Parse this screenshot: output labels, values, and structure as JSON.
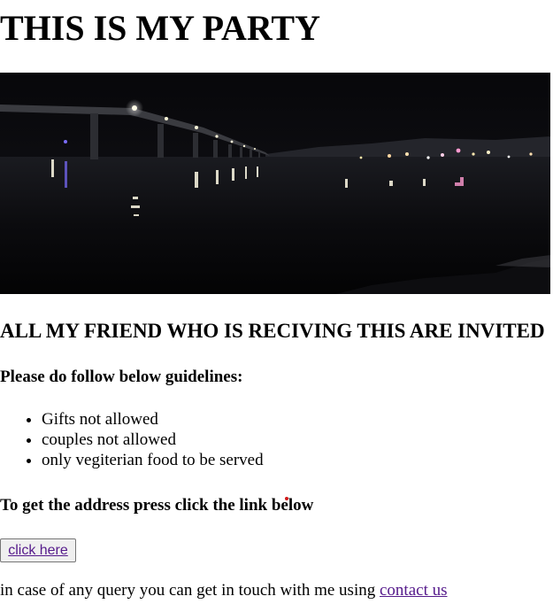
{
  "header": {
    "title": "THIS IS MY PARTY"
  },
  "hero": {
    "alt": "Night view of a long bridge over water with city lights reflecting"
  },
  "content": {
    "invite_heading": "ALL MY FRIEND WHO IS RECIVING THIS ARE INVITED",
    "guidelines_heading": "Please do follow below guidelines:",
    "guidelines": [
      "Gifts not allowed",
      "couples not allowed",
      "only vegiterian food to be served"
    ],
    "address_heading": "To get the address press click the link below",
    "button_label": "click here",
    "query_text": "in case of any query you can get in touch with me using ",
    "contact_link": "contact us"
  },
  "colors": {
    "link": "#551a8b",
    "button_bg": "#efefef",
    "button_border": "#767676"
  }
}
